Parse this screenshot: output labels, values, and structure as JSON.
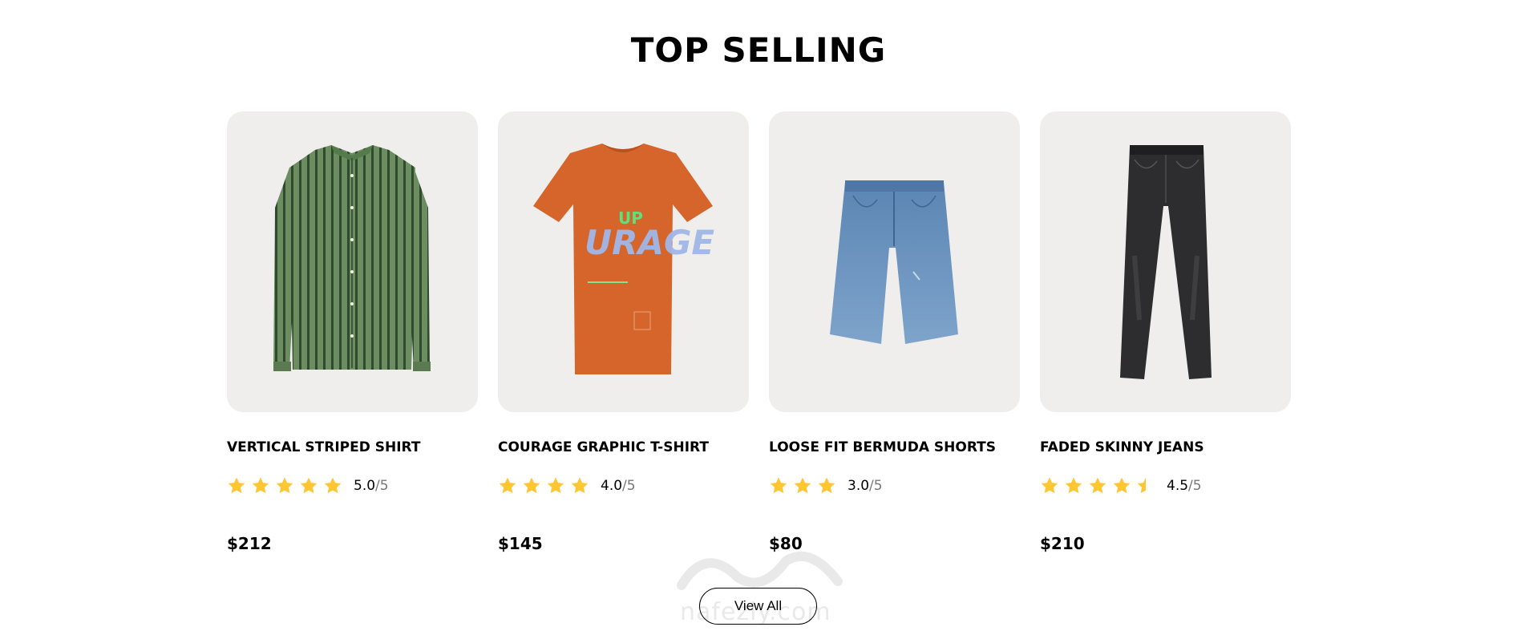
{
  "section": {
    "title": "TOP SELLING"
  },
  "products": [
    {
      "name": "VERTICAL STRIPED SHIRT",
      "rating": 5.0,
      "rating_value": "5.0",
      "rating_max": "/5",
      "price": "$212",
      "image_icon": "green-striped-shirt"
    },
    {
      "name": "COURAGE GRAPHIC T-SHIRT",
      "rating": 4.0,
      "rating_value": "4.0",
      "rating_max": "/5",
      "price": "$145",
      "image_icon": "orange-graphic-tshirt"
    },
    {
      "name": "LOOSE FIT BERMUDA SHORTS",
      "rating": 3.0,
      "rating_value": "3.0",
      "rating_max": "/5",
      "price": "$80",
      "image_icon": "denim-shorts"
    },
    {
      "name": "FADED SKINNY JEANS",
      "rating": 4.5,
      "rating_value": "4.5",
      "rating_max": "/5",
      "price": "$210",
      "image_icon": "black-skinny-jeans"
    }
  ],
  "view_all": {
    "label": "View All"
  },
  "watermark": {
    "text": "nafezly.com"
  },
  "colors": {
    "star": "#FFC633",
    "card_bg": "#F0EEED"
  }
}
